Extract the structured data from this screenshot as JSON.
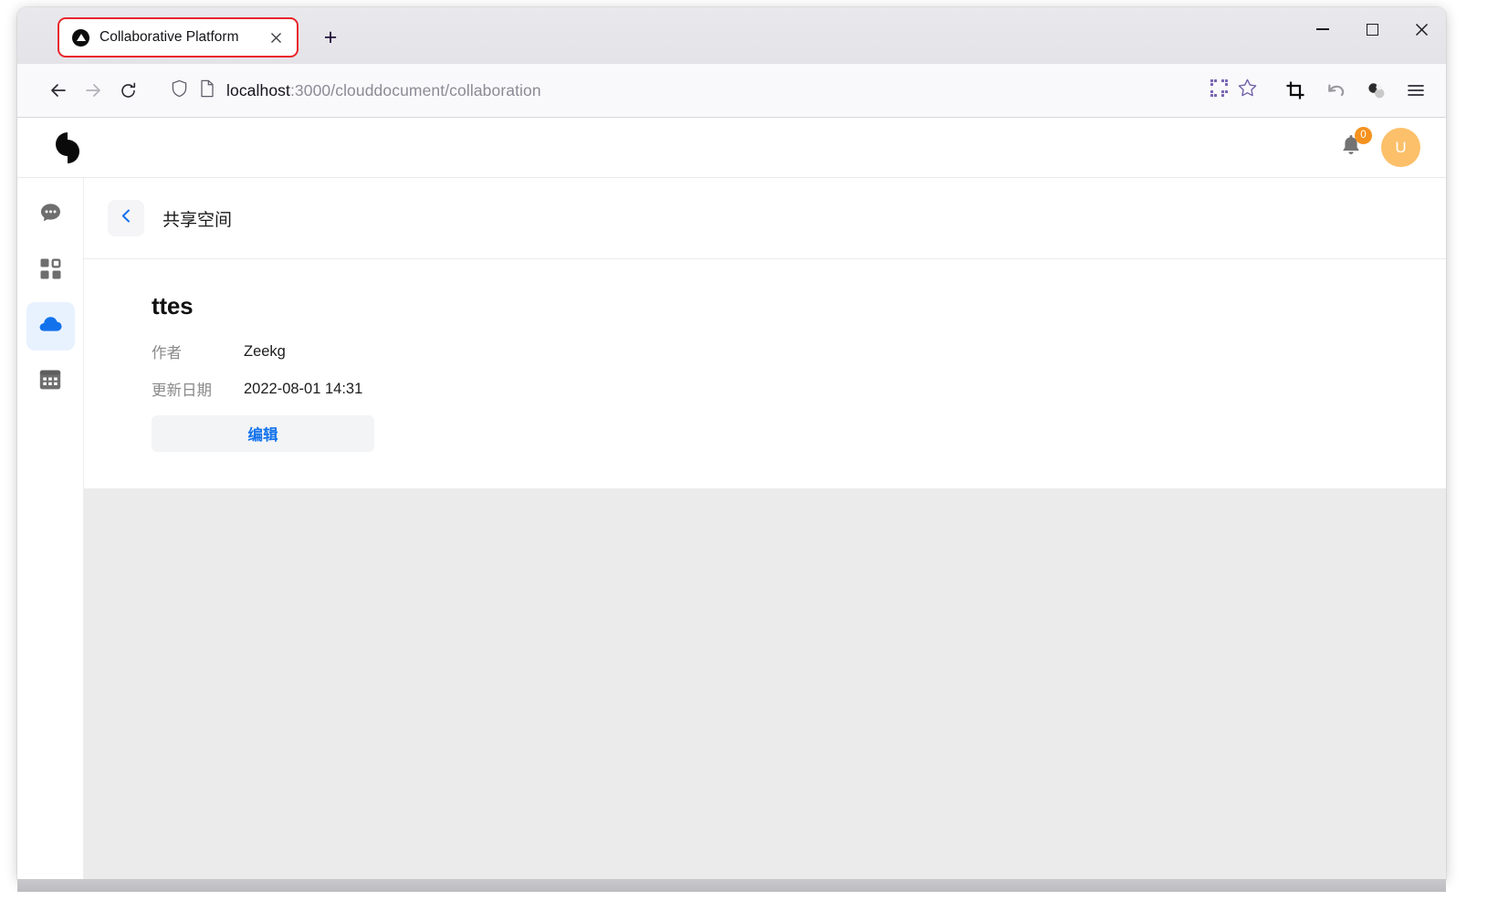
{
  "browser": {
    "tab": {
      "title": "Collaborative Platform",
      "favicon_icon": "triangle-in-circle-favicon",
      "close_icon": "close-icon"
    },
    "new_tab_label": "+",
    "window_controls": {
      "minimize_icon": "minimize-icon",
      "maximize_icon": "maximize-icon",
      "close_icon": "close-icon"
    },
    "nav": {
      "back_icon": "back-arrow-icon",
      "forward_icon": "forward-arrow-icon",
      "reload_icon": "reload-icon",
      "shield_icon": "shield-icon",
      "page_icon": "page-document-icon",
      "url_host": "localhost",
      "url_path": ":3000/clouddocument/collaboration",
      "url_full": "localhost:3000/clouddocument/collaboration",
      "qr_icon": "qr-code-icon",
      "bookmark_icon": "star-bookmark-icon",
      "screenshot_icon": "crop-screenshot-icon",
      "undo_icon": "undo-arrow-icon",
      "extension_icon": "extension-spheres-icon",
      "menu_icon": "hamburger-menu-icon"
    }
  },
  "app": {
    "logo_icon": "split-circle-logo",
    "notifications": {
      "bell_icon": "bell-icon",
      "count": "0",
      "badge_color": "#f5921e"
    },
    "avatar": {
      "initial": "U",
      "color": "#fcc06a"
    },
    "sidebar": {
      "items": [
        {
          "name": "chat",
          "icon": "chat-bubble-icon",
          "active": false
        },
        {
          "name": "apps",
          "icon": "grid-apps-icon",
          "active": false
        },
        {
          "name": "cloud-document",
          "icon": "cloud-icon",
          "active": true
        },
        {
          "name": "calendar",
          "icon": "calendar-grid-icon",
          "active": false
        }
      ],
      "active_color": "#1272ec",
      "active_bg": "#e8f2ff"
    },
    "breadcrumb": {
      "back_icon": "chevron-left-icon",
      "title": "共享空间"
    },
    "document": {
      "title": "ttes",
      "fields": [
        {
          "label": "作者",
          "value": "Zeekg"
        },
        {
          "label": "更新日期",
          "value": "2022-08-01 14:31"
        }
      ],
      "edit_button_label": "编辑",
      "edit_button_color": "#1272ec"
    }
  }
}
